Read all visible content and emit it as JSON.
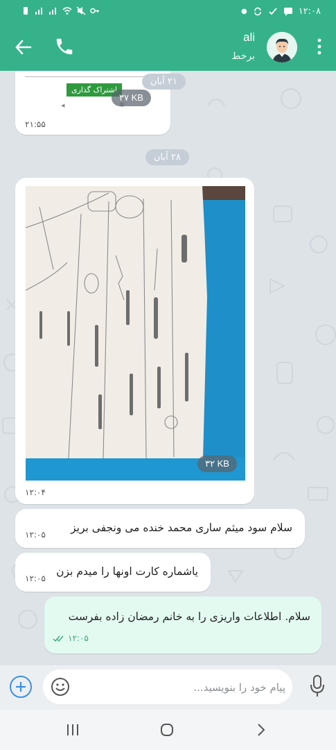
{
  "status_bar": {
    "time": "۱۲:۰۸"
  },
  "header": {
    "contact_name": "ali",
    "contact_status": "برخط"
  },
  "messages": {
    "earlier_file": {
      "date": "۲۱ آبان",
      "size": "۳۷ KB",
      "button_label": "اشتراک گذاری",
      "time": "۲۱:۵۵"
    },
    "date_separator": "۲۸ آبان",
    "photo": {
      "size": "۳۲ KB",
      "time": "۱۲:۰۴"
    },
    "msg1": {
      "text": "سلام سود میثم ساری محمد خنده می ونجفی بریز",
      "time": "۱۲:۰۵"
    },
    "msg2": {
      "text": "یاشماره کارت اونها را میدم بزن",
      "time": "۱۲:۰۵"
    },
    "msg3": {
      "text": "سلام. اطلاعات واریزی را به خانم رمضان زاده بفرست",
      "time": "۱۲:۰۵",
      "status": "read"
    }
  },
  "composer": {
    "placeholder": "پیام خود را بنویسید..."
  },
  "colors": {
    "accent": "#35b28a",
    "outgoing_bubble": "#e3faf1",
    "add_button": "#3b8fe6"
  }
}
